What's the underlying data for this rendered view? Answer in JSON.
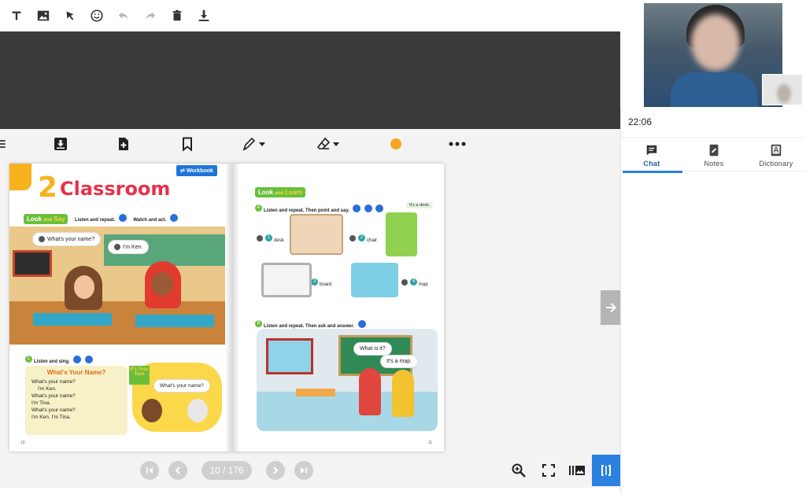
{
  "top_toolbar": {
    "tools": [
      "text-icon",
      "image-icon",
      "arrow-pointer-icon",
      "emoji-icon",
      "undo-icon",
      "redo-icon",
      "trash-icon",
      "download-icon"
    ]
  },
  "reader_toolbar": {
    "tools": [
      "menu-icon",
      "save-page-icon",
      "add-page-icon",
      "bookmark-icon",
      "pen-icon",
      "eraser-icon",
      "color-dot-icon",
      "more-icon"
    ],
    "pen_color": "#f5a623"
  },
  "book": {
    "left_page": {
      "unit_number": "2",
      "unit_title": "Classroom",
      "workbook_label": "Workbook",
      "section_tag": {
        "part1": "Look",
        "part2": "and",
        "part3": "Say"
      },
      "instruction_a": "Listen and repeat.",
      "instruction_b": "Watch and act.",
      "bubble_1": "What's your name?",
      "bubble_2": "I'm Ken.",
      "listen_sing": "Listen and sing.",
      "song_title": "What's Your Name?",
      "song_lines": [
        "What's your name?",
        "I'm Ken.",
        "What's your name?",
        "I'm Tina.",
        "What's your name?",
        "I'm Ken. I'm Tina."
      ],
      "your_turn": "It's Your Turn",
      "turn_bubble": "What's your name?",
      "page_number": "10"
    },
    "right_page": {
      "section_tag": {
        "part1": "Look",
        "part2": "and",
        "part3": "Learn"
      },
      "instruction_a": "Listen and repeat. Then point and say.",
      "hint": "It's a desk.",
      "items": [
        {
          "num": "1",
          "word": "desk"
        },
        {
          "num": "2",
          "word": "chair"
        },
        {
          "num": "3",
          "word": "board"
        },
        {
          "num": "4",
          "word": "map"
        }
      ],
      "instruction_b": "Listen and repeat. Then ask and answer.",
      "bubble_1": "What is it?",
      "bubble_2": "It's a map.",
      "page_number": "11"
    }
  },
  "pagination": {
    "indicator": "10 / 176"
  },
  "side_panel": {
    "timer": "22:06",
    "tabs": [
      {
        "label": "Chat"
      },
      {
        "label": "Notes"
      },
      {
        "label": "Dictionary"
      }
    ],
    "active_tab": "Chat"
  }
}
